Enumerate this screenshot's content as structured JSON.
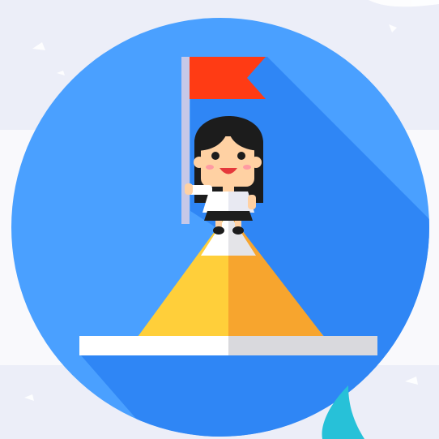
{
  "illustration": {
    "subject": "flag-on-mountain-icon",
    "colors": {
      "circle": "#4aa0ff",
      "circle_shadow": "#2f86f5",
      "flag": "#ff3b14",
      "pole": "#c6c8e8",
      "mountain_left": "#ffcf3a",
      "mountain_right": "#f7a52e",
      "snow_left": "#ffffff",
      "snow_right": "#e4e4e8",
      "base_left": "#ffffff",
      "base_right": "#d9d9dd",
      "hair": "#1c1c1c",
      "skin": "#ffd1a3",
      "shirt": "#ffffff",
      "skirt": "#1e1e1e",
      "accent_swoosh": "#27c1d8"
    }
  }
}
